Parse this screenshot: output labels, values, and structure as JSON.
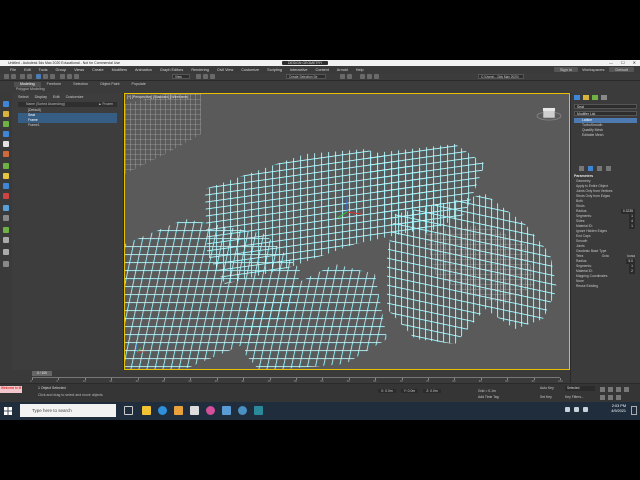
{
  "window": {
    "title": "Untitled - Autodesk 3ds Max 2020 Educational - Not for Commercial Use",
    "doc_tab": "DESIGN GEOMETRY",
    "controls": [
      "—",
      "☐",
      "✕"
    ]
  },
  "menu": {
    "items": [
      "File",
      "Edit",
      "Tools",
      "Group",
      "Views",
      "Create",
      "Modifiers",
      "Animation",
      "Graph Editors",
      "Rendering",
      "Civil View",
      "Customize",
      "Scripting",
      "Interactive",
      "Content",
      "Arnold",
      "Help"
    ],
    "sign_in": "Sign In",
    "workspace_label": "Workspaces:",
    "workspace_value": "Default"
  },
  "toolbar": {
    "create_selection_set": "Create Selection Se",
    "view_field": "View",
    "project_field": "C:\\Users\\...\\3ds Max 2020\\"
  },
  "ribbon": {
    "tabs": [
      "Modeling",
      "Freeform",
      "Selection",
      "Object Paint",
      "Populate"
    ],
    "active_tab": "Modeling",
    "subtitle": "Polygon Modeling"
  },
  "scene_explorer": {
    "menus": [
      "Select",
      "Display",
      "Edit",
      "Customize"
    ],
    "header_name": "Name (Sorted Ascending)",
    "header_frozen": "▲ Frozen",
    "rows": [
      {
        "label": "[Default]",
        "selected": false
      },
      {
        "label": "Seat",
        "selected": true
      },
      {
        "label": "Frame",
        "selected": true
      },
      {
        "label": "Frame1",
        "selected": false
      }
    ],
    "layer_label": "Default"
  },
  "viewport": {
    "label": "[+] [Perspective] [Standard] [Wireframe]"
  },
  "command_panel": {
    "object_name": "Seat",
    "modifier_list_label": "Modifier List",
    "modifiers": [
      {
        "label": "Lattice",
        "selected": true
      },
      {
        "label": "TurboSmooth",
        "selected": false
      },
      {
        "label": "Quadify Mesh",
        "selected": false
      },
      {
        "label": "Editable Mesh",
        "selected": false
      }
    ],
    "parameters_title": "Parameters",
    "geometry_label": "Geometry",
    "geometry_options": [
      "Apply to Entire Object",
      "Joints Only from Vertices",
      "Struts Only from Edges",
      "Both"
    ],
    "struts_title": "Struts",
    "struts": [
      {
        "label": "Radius:",
        "value": "0.3235"
      },
      {
        "label": "Segments:",
        "value": "1"
      },
      {
        "label": "Sides:",
        "value": "4"
      },
      {
        "label": "Material ID:",
        "value": "1"
      }
    ],
    "struts_checks": [
      "Ignore Hidden Edges",
      "End Caps",
      "Smooth"
    ],
    "joints_title": "Joints",
    "joints_type_label": "Geodesic Base Type",
    "joints_types": [
      "Tetra",
      "Octa",
      "Icosa"
    ],
    "joints": [
      {
        "label": "Radius:",
        "value": "5.0"
      },
      {
        "label": "Segments:",
        "value": "1"
      },
      {
        "label": "Material ID:",
        "value": "2"
      }
    ],
    "mapping_title": "Mapping Coordinates",
    "mapping_options": [
      "None",
      "Reuse Existing"
    ]
  },
  "timeline": {
    "slider": "0 / 100",
    "ticks": [
      "0",
      "5",
      "10",
      "15",
      "20",
      "25",
      "30",
      "35",
      "40",
      "45",
      "50",
      "55",
      "60",
      "65",
      "70",
      "75",
      "80",
      "85",
      "90",
      "95",
      "100"
    ]
  },
  "status": {
    "maxscript": "Welcome to M",
    "line1": "1 Object Selected",
    "line2": "Click and drag to select and move objects",
    "x": "X: 0.0m",
    "y": "Y: 0.0m",
    "z": "Z: 0.0m",
    "grid": "Grid = 0.1m",
    "add_time_tag": "Add Time Tag",
    "auto_key": "Auto Key",
    "selected": "Selected",
    "set_key": "Set Key",
    "key_filters": "Key Filters..."
  },
  "taskbar": {
    "search_placeholder": "Type here to search",
    "time": "2:03 PM",
    "date": "4/9/2021"
  },
  "colors": {
    "viewport_bg": "#5a5a5a",
    "wire_main": "#ffffff",
    "wire_edge": "#48e0ee",
    "active_border": "#e8c000",
    "taskbar": "#1f2d3d"
  }
}
